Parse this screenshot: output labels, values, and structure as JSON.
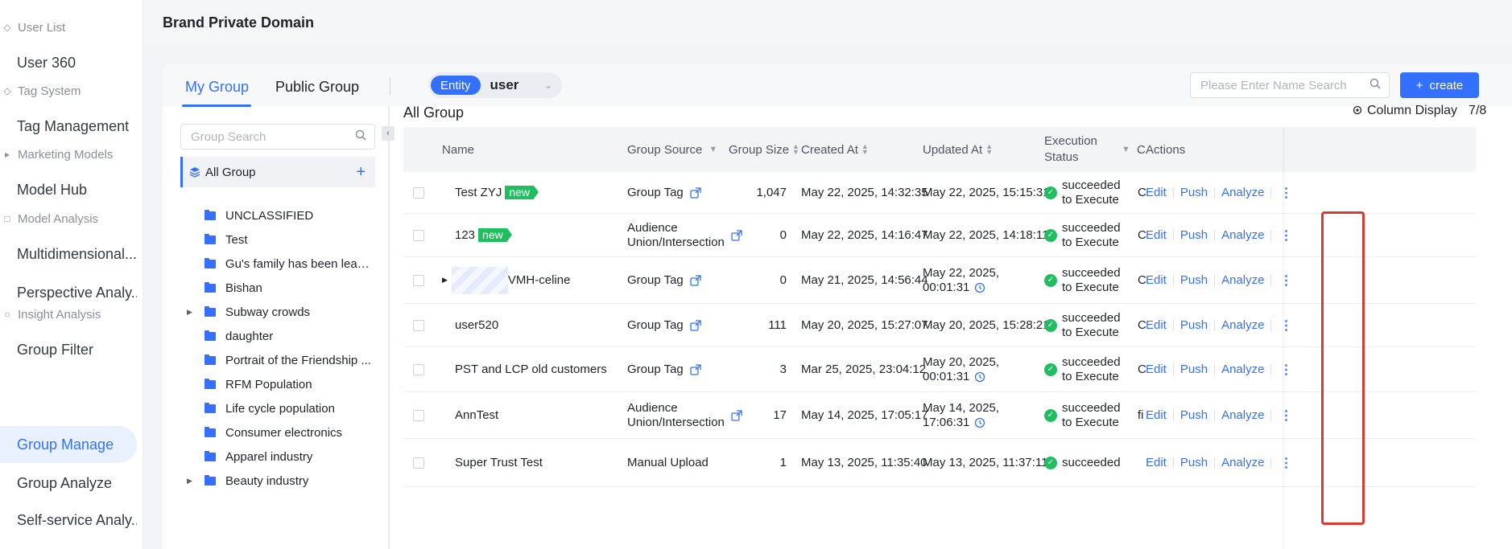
{
  "leftnav": {
    "sections": [
      {
        "label": "User List",
        "items": [
          "User 360"
        ]
      },
      {
        "label": "Tag System",
        "items": [
          "Tag Management"
        ]
      },
      {
        "label": "Marketing Models",
        "items": [
          "Model Hub"
        ]
      },
      {
        "label": "Model Analysis",
        "items": [
          "Multidimensional...",
          "Perspective Analy..."
        ]
      },
      {
        "label": "Insight Analysis",
        "items": [
          "Group Filter",
          "Group Manage",
          "Group Analyze",
          "Self-service Analy..."
        ]
      }
    ]
  },
  "header": {
    "title": "Brand Private Domain"
  },
  "tabs": {
    "my_group": "My Group",
    "public_group": "Public Group"
  },
  "entity": {
    "badge": "Entity",
    "value": "user"
  },
  "search": {
    "placeholder": "Please Enter Name Search"
  },
  "create_button": {
    "label": "create"
  },
  "tree": {
    "search_placeholder": "Group Search",
    "all_group": "All Group",
    "items": [
      {
        "label": "UNCLASSIFIED",
        "expandable": false
      },
      {
        "label": "Test",
        "expandable": false
      },
      {
        "label": "Gu's family has been leadi...",
        "expandable": false
      },
      {
        "label": "Bishan",
        "expandable": false
      },
      {
        "label": "Subway crowds",
        "expandable": true
      },
      {
        "label": "daughter",
        "expandable": false
      },
      {
        "label": "Portrait of the Friendship ...",
        "expandable": false
      },
      {
        "label": "RFM Population",
        "expandable": false
      },
      {
        "label": "Life cycle population",
        "expandable": false
      },
      {
        "label": "Consumer electronics",
        "expandable": false
      },
      {
        "label": "Apparel industry",
        "expandable": false
      },
      {
        "label": "Beauty industry",
        "expandable": true
      }
    ]
  },
  "table": {
    "section_title": "All Group",
    "column_display": {
      "label": "Column Display",
      "count": "7/8"
    },
    "columns": {
      "name": "Name",
      "group_source": "Group Source",
      "group_size": "Group Size",
      "created_at": "Created At",
      "updated_at": "Updated At",
      "execution_status_1": "Execution",
      "execution_status_2": "Status",
      "hidden_col": "C",
      "actions": "Actions"
    },
    "rows": [
      {
        "name": "Test ZYJ",
        "new": "new",
        "source_1": "Group Tag",
        "source_2": "",
        "size": "1,047",
        "created": "May 22, 2025, 14:32:35",
        "updated_1": "May 22, 2025, 15:15:31",
        "updated_2": "",
        "status_1": "succeeded",
        "status_2": "to Execute",
        "hidden": "C",
        "edit": "Edit",
        "push": "Push",
        "analyze": "Analyze"
      },
      {
        "name": "123",
        "new": "new",
        "source_1": "Audience",
        "source_2": "Union/Intersection",
        "size": "0",
        "created": "May 22, 2025, 14:16:47",
        "updated_1": "May 22, 2025, 14:18:11",
        "updated_2": "",
        "status_1": "succeeded",
        "status_2": "to Execute",
        "hidden": "C",
        "edit": "Edit",
        "push": "Push",
        "analyze": "Analyze"
      },
      {
        "name": "VMH-celine",
        "new": "",
        "source_1": "Group Tag",
        "source_2": "",
        "size": "0",
        "created": "May 21, 2025, 14:56:44",
        "updated_1": "May 22, 2025,",
        "updated_2": "00:01:31",
        "status_1": "succeeded",
        "status_2": "to Execute",
        "hidden": "C",
        "edit": "Edit",
        "push": "Push",
        "analyze": "Analyze"
      },
      {
        "name": "user520",
        "new": "",
        "source_1": "Group Tag",
        "source_2": "",
        "size": "111",
        "created": "May 20, 2025, 15:27:07",
        "updated_1": "May 20, 2025, 15:28:21",
        "updated_2": "",
        "status_1": "succeeded",
        "status_2": "to Execute",
        "hidden": "C",
        "edit": "Edit",
        "push": "Push",
        "analyze": "Analyze"
      },
      {
        "name": "PST and LCP old customers",
        "new": "",
        "source_1": "Group Tag",
        "source_2": "",
        "size": "3",
        "created": "Mar 25, 2025, 23:04:12",
        "updated_1": "May 20, 2025,",
        "updated_2": "00:01:31",
        "status_1": "succeeded",
        "status_2": "to Execute",
        "hidden": "C",
        "edit": "Edit",
        "push": "Push",
        "analyze": "Analyze"
      },
      {
        "name": "AnnTest",
        "new": "",
        "source_1": "Audience",
        "source_2": "Union/Intersection",
        "size": "17",
        "created": "May 14, 2025, 17:05:17",
        "updated_1": "May 14, 2025,",
        "updated_2": "17:06:31",
        "status_1": "succeeded",
        "status_2": "to Execute",
        "hidden": "fi",
        "edit": "Edit",
        "push": "Push",
        "analyze": "Analyze"
      },
      {
        "name": "Super Trust Test",
        "new": "",
        "source_1": "Manual Upload",
        "source_2": "",
        "size": "1",
        "created": "May 13, 2025, 11:35:40",
        "updated_1": "May 13, 2025, 11:37:11",
        "updated_2": "",
        "status_1": "succeeded",
        "status_2": "",
        "hidden": "",
        "edit": "Edit",
        "push": "Push",
        "analyze": "Analyze"
      }
    ]
  },
  "colors": {
    "accent": "#3370ff",
    "success": "#1fbf5f",
    "highlight": "#d93a32"
  },
  "icons": [
    "search-icon",
    "plus-icon",
    "layers-icon",
    "folder-icon",
    "caret-right-icon",
    "chevron-left-icon",
    "chevron-down-icon",
    "gear-icon",
    "sort-icon",
    "filter-icon",
    "share-icon",
    "clock-icon",
    "check-circle-icon",
    "more-vertical-icon"
  ]
}
